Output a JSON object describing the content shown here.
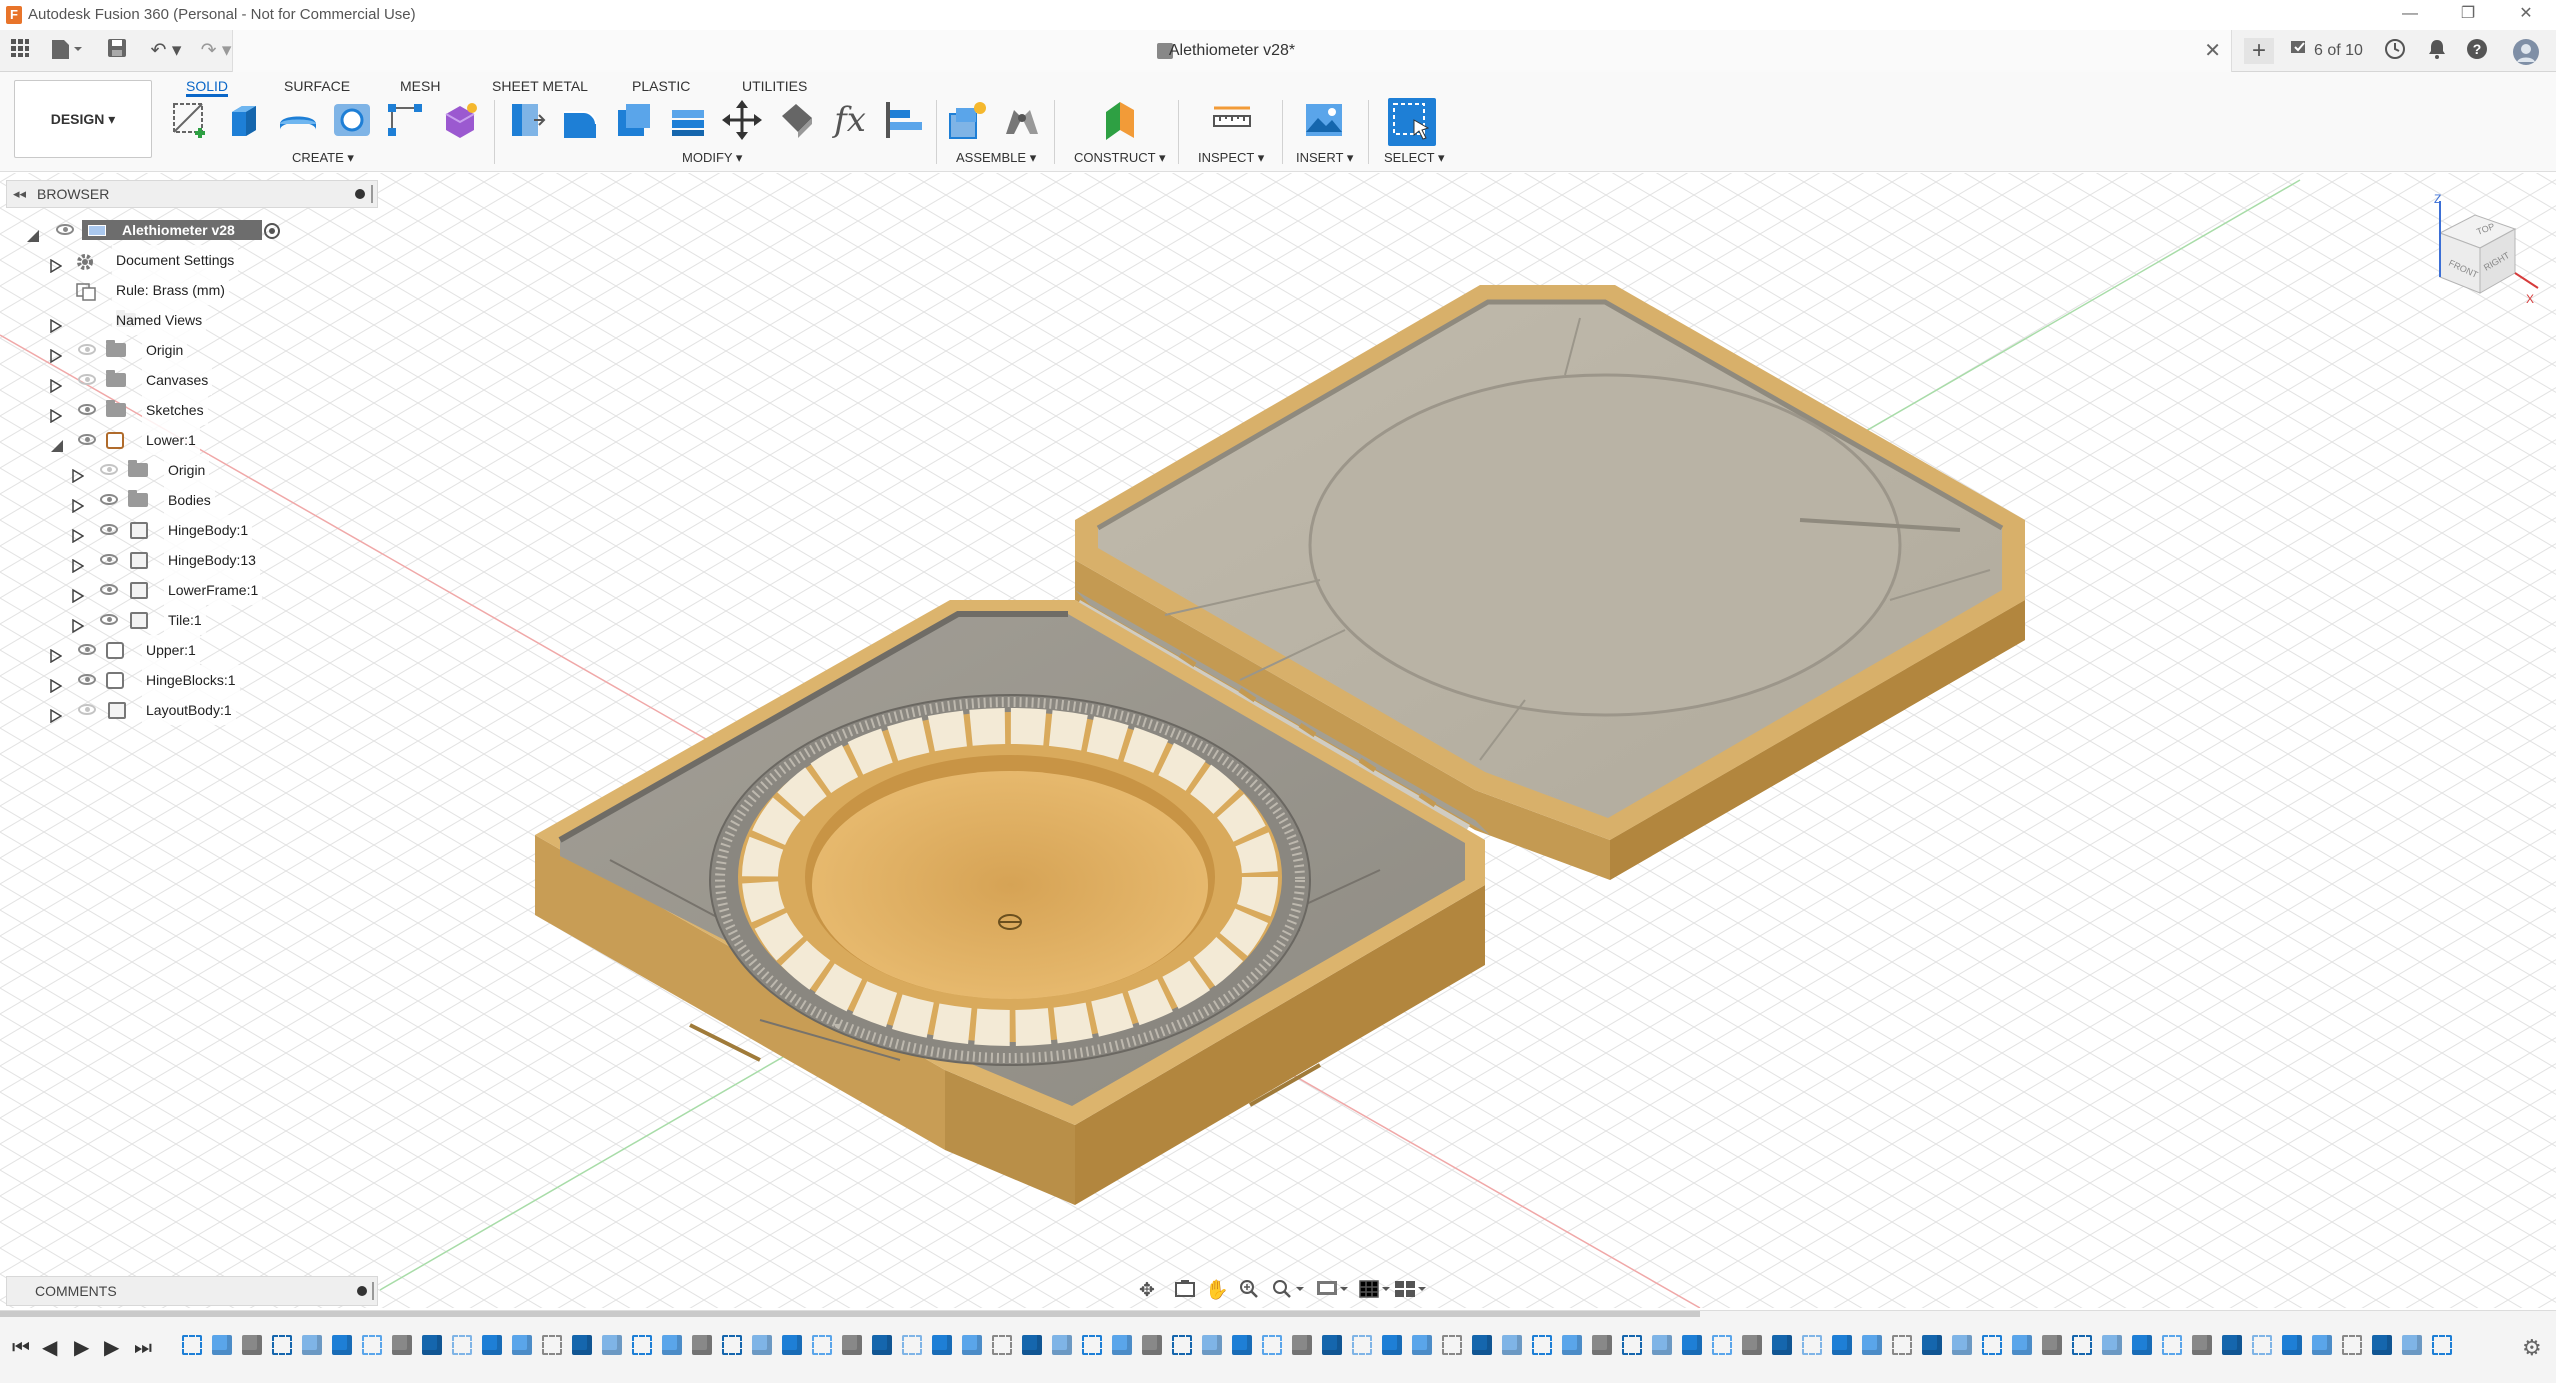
{
  "window": {
    "app_title": "Autodesk Fusion 360 (Personal - Not for Commercial Use)",
    "minimize": "—",
    "restore": "❐",
    "close": "✕"
  },
  "tabbar": {
    "document_title": "Alethiometer v28*",
    "tab_close": "✕",
    "new_tab": "+",
    "job_status": "6 of 10"
  },
  "ribbon": {
    "workspace": "DESIGN ▾",
    "tabs": [
      "SOLID",
      "SURFACE",
      "MESH",
      "SHEET METAL",
      "PLASTIC",
      "UTILITIES"
    ],
    "active_tab": "SOLID",
    "groups": [
      "CREATE ▾",
      "MODIFY ▾",
      "ASSEMBLE ▾",
      "CONSTRUCT ▾",
      "INSPECT ▾",
      "INSERT ▾",
      "SELECT ▾"
    ],
    "fx_label": "fx"
  },
  "browser": {
    "title": "BROWSER",
    "root": "Alethiometer v28",
    "items": [
      "Document Settings",
      "Rule: Brass (mm)",
      "Named Views",
      "Origin",
      "Canvases",
      "Sketches",
      "Lower:1",
      "Origin",
      "Bodies",
      "HingeBody:1",
      "HingeBody:13",
      "LowerFrame:1",
      "Tile:1",
      "Upper:1",
      "HingeBlocks:1",
      "LayoutBody:1"
    ]
  },
  "comments": {
    "title": "COMMENTS"
  },
  "viewcube": {
    "top": "TOP",
    "front": "FRONT",
    "right": "RIGHT",
    "z": "Z",
    "x": "X"
  },
  "colors": {
    "accent": "#0a67c8",
    "brass": "#d2a862",
    "brass_dark": "#b58c45",
    "interior": "#b9b2a3",
    "interior_dark": "#9b9689",
    "grid_line": "#dcdcdc"
  }
}
